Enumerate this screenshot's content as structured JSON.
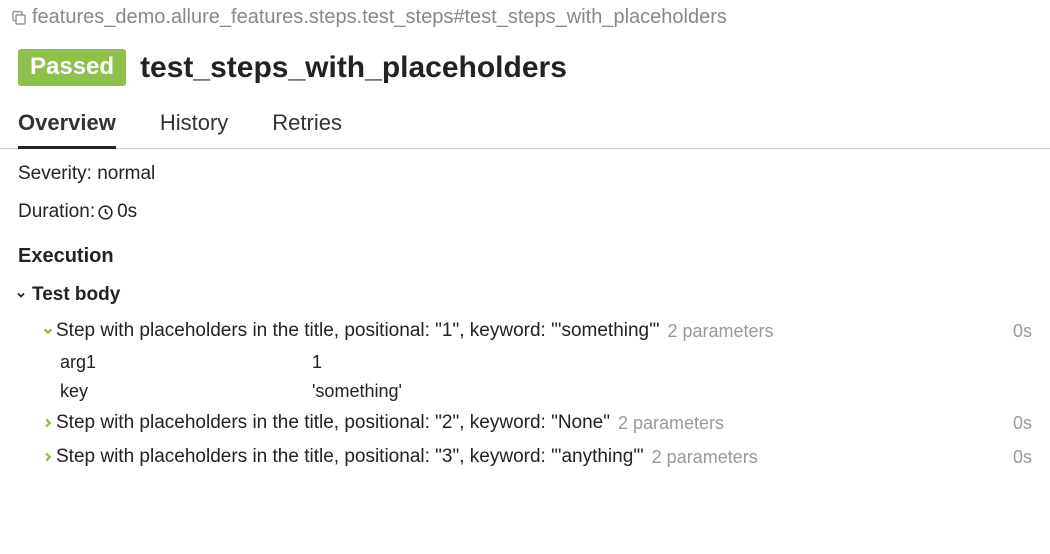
{
  "breadcrumb": "features_demo.allure_features.steps.test_steps#test_steps_with_placeholders",
  "status": "Passed",
  "title": "test_steps_with_placeholders",
  "tabs": {
    "overview": "Overview",
    "history": "History",
    "retries": "Retries"
  },
  "meta": {
    "severity_label": "Severity:",
    "severity_value": "normal",
    "duration_label": "Duration:",
    "duration_value": "0s"
  },
  "execution_header": "Execution",
  "test_body_label": "Test body",
  "steps": [
    {
      "title": "Step with placeholders in the title, positional: \"1\", keyword: \"'something'\"",
      "param_count": "2 parameters",
      "duration": "0s",
      "expanded": true,
      "params": [
        {
          "key": "arg1",
          "value": "1"
        },
        {
          "key": "key",
          "value": "'something'"
        }
      ]
    },
    {
      "title": "Step with placeholders in the title, positional: \"2\", keyword: \"None\"",
      "param_count": "2 parameters",
      "duration": "0s",
      "expanded": false
    },
    {
      "title": "Step with placeholders in the title, positional: \"3\", keyword: \"'anything'\"",
      "param_count": "2 parameters",
      "duration": "0s",
      "expanded": false
    }
  ]
}
